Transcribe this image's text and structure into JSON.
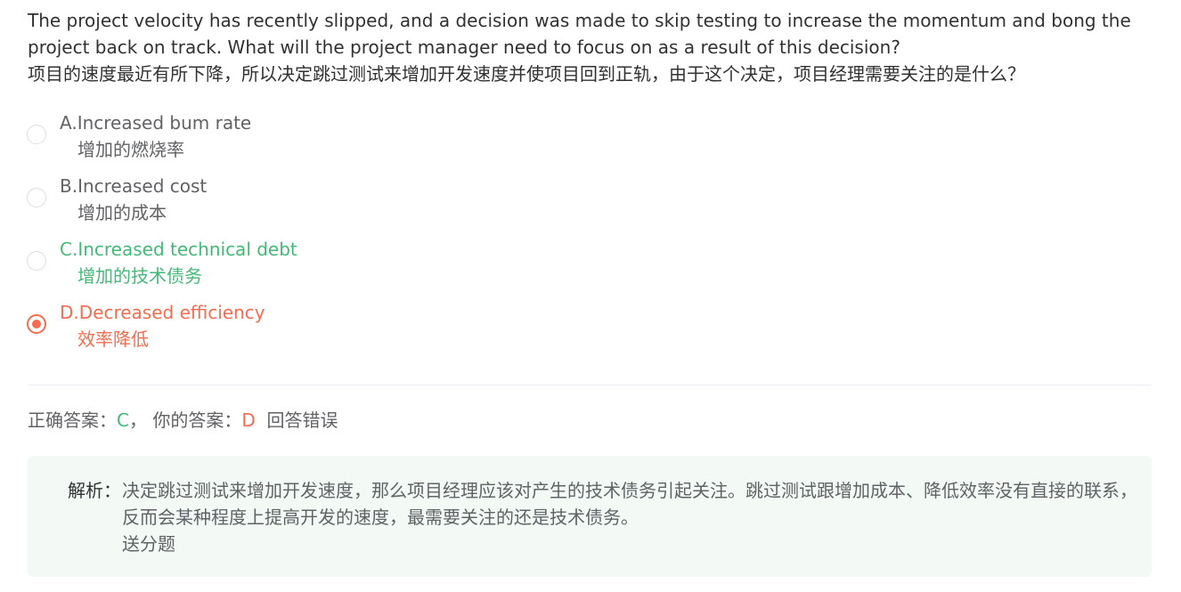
{
  "question": {
    "en": "The project velocity has recently slipped, and a decision was made to skip testing to increase the momentum and bong the project back on track. What will the project manager need to focus on as a result of this decision?",
    "zh": "项目的速度最近有所下降，所以决定跳过测试来增加开发速度并使项目回到正轨，由于这个决定，项目经理需要关注的是什么？"
  },
  "options": [
    {
      "en": "A.Increased bum rate",
      "zh": "增加的燃烧率",
      "state": "normal",
      "selected": false
    },
    {
      "en": "B.Increased cost",
      "zh": "增加的成本",
      "state": "normal",
      "selected": false
    },
    {
      "en": "C.Increased technical debt",
      "zh": "增加的技术债务",
      "state": "correct",
      "selected": false
    },
    {
      "en": "D.Decreased efficiency",
      "zh": "效率降低",
      "state": "wrong",
      "selected": true
    }
  ],
  "result": {
    "correct_label": "正确答案：",
    "correct_value": "C",
    "separator": "，",
    "your_label": "你的答案：",
    "your_value": "D",
    "verdict": "回答错误"
  },
  "analysis": {
    "label": "解析：",
    "text": "决定跳过测试来增加开发速度，那么项目经理应该对产生的技术债务引起关注。跳过测试跟增加成本、降低效率没有直接的联系，反而会某种程度上提高开发的速度，最需要关注的还是技术债务。",
    "note": "送分题"
  },
  "colors": {
    "correct": "#43b977",
    "wrong": "#f56c4e",
    "text": "#606266",
    "analysis_bg": "#f3f9f5"
  }
}
